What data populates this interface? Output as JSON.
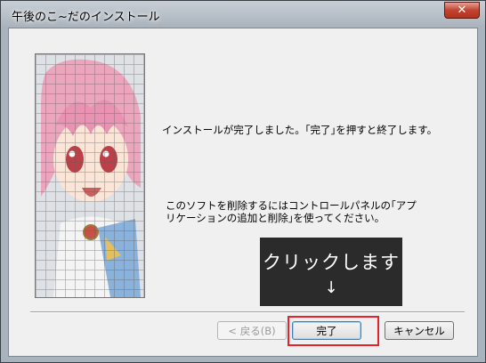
{
  "window": {
    "title": "午後のこ~だのインストール",
    "close_label": "✕"
  },
  "content": {
    "message_complete": "インストールが完了しました。｢完了｣を押すと終了します。",
    "message_uninstall": "このソフトを削除するにはコントロールパネルの｢アプリケーションの追加と削除｣を使ってください。"
  },
  "overlay": {
    "line1": "クリックします",
    "line2": "↓"
  },
  "buttons": {
    "back": "< 戻る(B)",
    "finish": "完了",
    "cancel": "キャンセル"
  },
  "colors": {
    "highlight": "#e8222a",
    "overlay_bg": "#2b2b2b"
  }
}
